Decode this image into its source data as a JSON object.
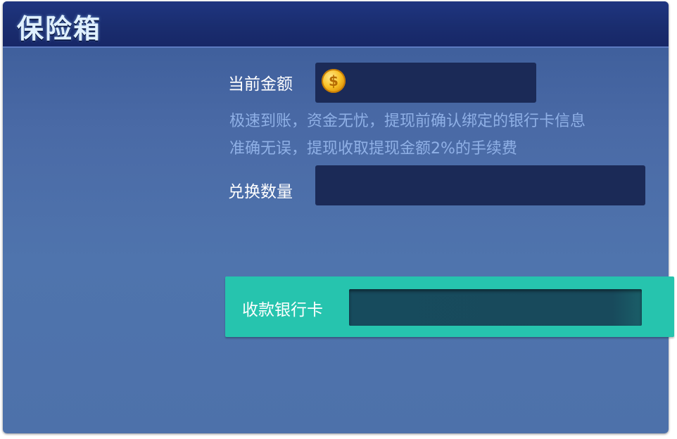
{
  "header": {
    "title": "保险箱"
  },
  "form": {
    "current_amount_label": "当前金额",
    "current_amount_value": "",
    "coin_icon": "gold-coin-icon",
    "note_line1": "极速到账，资金无忧，提现前确认绑定的银行卡信息",
    "note_line2": "准确无误，提现收取提现金额2%的手续费",
    "exchange_qty_label": "兑换数量",
    "exchange_qty_value": "",
    "bank_card_label": "收款银行卡",
    "bank_card_value": ""
  },
  "colors": {
    "panel": "#4d71aa",
    "header": "#1a2d6f",
    "field": "#1b2a57",
    "accent": "#26c4ae",
    "note_text": "#8fb0e6"
  }
}
